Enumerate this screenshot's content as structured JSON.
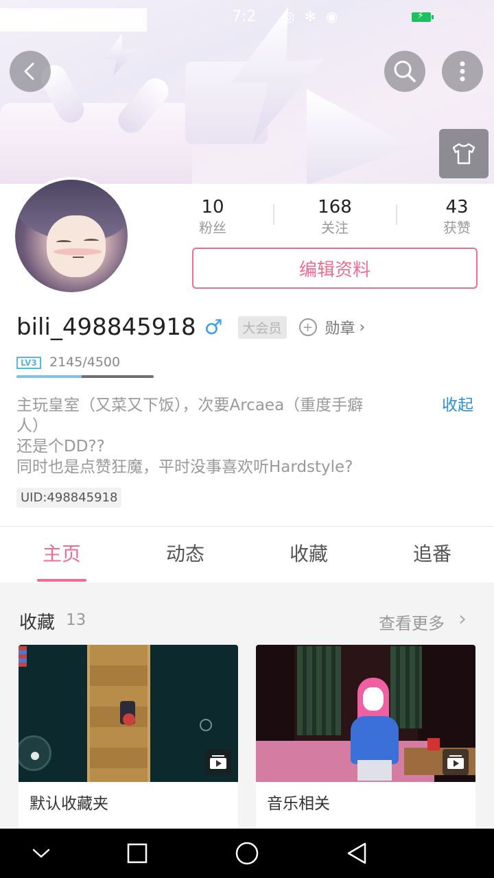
{
  "status_bar": {
    "time": "7:2",
    "icons": "◎ ✻ ◉"
  },
  "profile": {
    "followers": {
      "value": "10",
      "label": "粉丝"
    },
    "following": {
      "value": "168",
      "label": "关注"
    },
    "likes": {
      "value": "43",
      "label": "获赞"
    },
    "edit_label": "编辑资料",
    "username": "bili_498845918",
    "gender_symbol": "♂",
    "vip_label": "大会员",
    "medal_label": "勋章",
    "medal_chevron": "›",
    "level_label": "LV3",
    "exp_text": "2145/4500",
    "exp_fraction": 0.477,
    "bio_lines": [
      "主玩皇室（又菜又下饭），次要Arcaea（重度手癖",
      "人）",
      "还是个DD??",
      "同时也是点赞狂魔，平时没事喜欢听Hardstyle?"
    ],
    "collapse_label": "收起",
    "uid_text": "UID:498845918"
  },
  "tabs": [
    "主页",
    "动态",
    "收藏",
    "追番"
  ],
  "active_tab_index": 0,
  "favorites": {
    "title": "收藏",
    "count": "13",
    "see_more": "查看更多",
    "see_more_chevron": "›",
    "cards": [
      {
        "title": "默认收藏夹"
      },
      {
        "title": "音乐相关"
      }
    ]
  },
  "colors": {
    "accent_pink": "#f06c8f",
    "link_blue": "#2b8fd8",
    "gender_blue": "#3f9ee6",
    "level_blue": "#55b6e0",
    "battery_green": "#1cc05f"
  },
  "icons": {
    "back": "back-arrow-icon",
    "search": "search-icon",
    "more": "more-vertical-icon",
    "skin": "tshirt-icon",
    "medal": "medal-plus-icon",
    "play": "playlist-play-icon",
    "nav": [
      "chevron-down-icon",
      "square-recents-icon",
      "circle-home-icon",
      "triangle-back-icon"
    ]
  }
}
